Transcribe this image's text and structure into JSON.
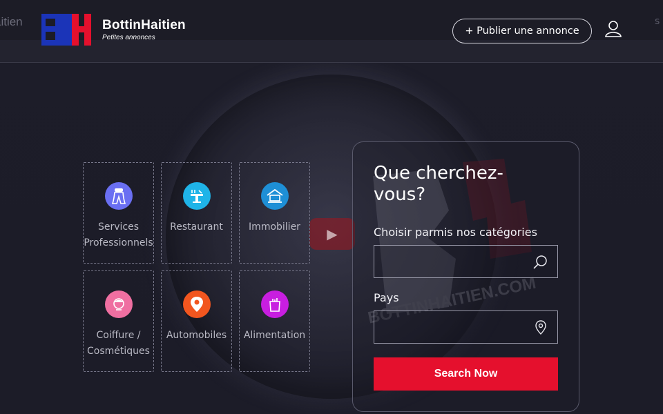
{
  "header": {
    "ghost_left_text": "aitien",
    "ghost_right_text": "s",
    "logo": {
      "name": "BottinHaitien",
      "tagline": "Petites annonces"
    },
    "publish_label": "+ Publier une annonce",
    "user_icon": "user-icon"
  },
  "hero": {
    "watermark_text": "BOTTINHAITIEN.COM",
    "play_icon": "play-icon"
  },
  "categories": [
    {
      "label": "Services Professionnels",
      "icon": "professional-icon",
      "color": "#6a6ff2"
    },
    {
      "label": "Restaurant",
      "icon": "restaurant-icon",
      "color": "#1fb4e8"
    },
    {
      "label": "Immobilier",
      "icon": "house-icon",
      "color": "#1e8fd6"
    },
    {
      "label": "Coiffure / Cosmétiques",
      "icon": "beauty-icon",
      "color": "#ef6fa1"
    },
    {
      "label": "Automobiles",
      "icon": "location-pin-icon",
      "color": "#f2561f"
    },
    {
      "label": "Alimentation",
      "icon": "grocery-bag-icon",
      "color": "#c81ee0"
    }
  ],
  "search": {
    "title": "Que cherchez-vous?",
    "category_label": "Choisir parmis nos catégories",
    "category_value": "",
    "country_label": "Pays",
    "country_value": "",
    "button_label": "Search Now",
    "button_color": "#e5102d"
  },
  "colors": {
    "brand_blue": "#1b34b8",
    "brand_red": "#e5102d",
    "background": "#1b1b26"
  }
}
